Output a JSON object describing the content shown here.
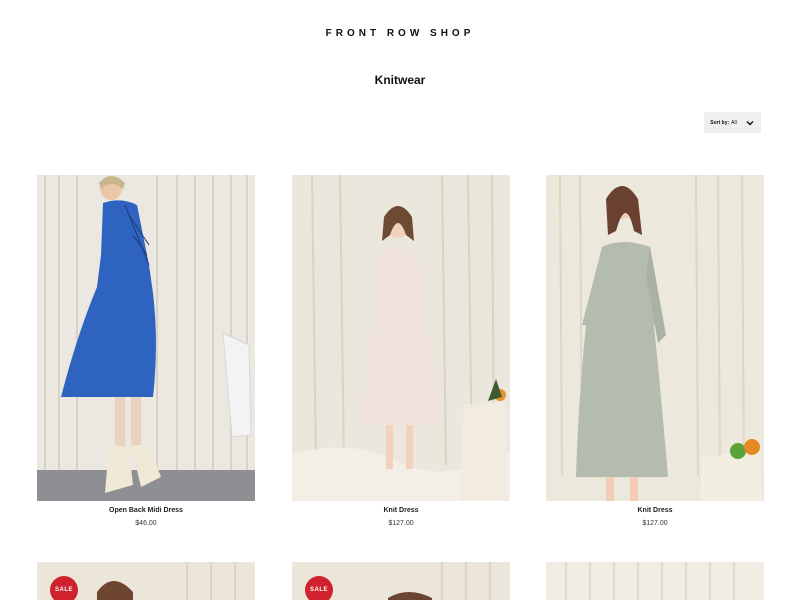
{
  "header": {
    "brand": "FRONT ROW SHOP"
  },
  "collection": {
    "title": "Knitwear"
  },
  "sort": {
    "label": "Sort by:",
    "value": "All",
    "icon": "chevron-down-icon"
  },
  "products": [
    {
      "name": "Open Back Midi Dress",
      "price": "$46.00",
      "dress_color": "#2e63bf"
    },
    {
      "name": "Knit Dress",
      "price": "$127.00",
      "dress_color": "#f0e2dd"
    },
    {
      "name": "Knit Dress",
      "price": "$127.00",
      "dress_color": "#b3bcaf"
    }
  ],
  "products_row2": [
    {
      "badge": "SALE"
    },
    {
      "badge": "SALE"
    },
    {
      "badge": ""
    }
  ],
  "colors": {
    "sale_badge": "#d0222d",
    "sort_bg": "#efefef"
  }
}
